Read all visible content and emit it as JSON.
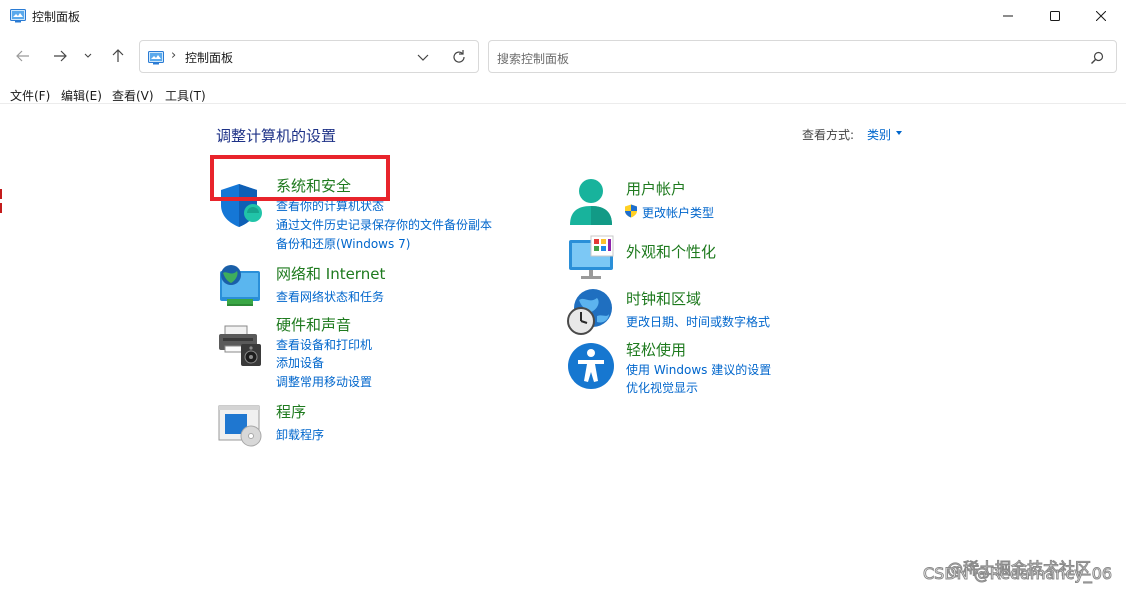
{
  "window": {
    "title": "控制面板"
  },
  "address_bar": {
    "separator": "›",
    "path": "控制面板"
  },
  "search": {
    "placeholder": "搜索控制面板"
  },
  "menu": [
    "文件(F)",
    "编辑(E)",
    "查看(V)",
    "工具(T)"
  ],
  "page": {
    "title": "调整计算机的设置",
    "view_by_label": "查看方式:",
    "view_by_value": "类别"
  },
  "categories": [
    {
      "title": "系统和安全",
      "icon": "shield-icon",
      "links": [
        "查看你的计算机状态",
        "通过文件历史记录保存你的文件备份副本",
        "备份和还原(Windows 7)"
      ]
    },
    {
      "title": "网络和 Internet",
      "icon": "network-globe-icon",
      "links": [
        "查看网络状态和任务"
      ]
    },
    {
      "title": "硬件和声音",
      "icon": "printer-speaker-icon",
      "links": [
        "查看设备和打印机",
        "添加设备",
        "调整常用移动设置"
      ]
    },
    {
      "title": "程序",
      "icon": "programs-icon",
      "links": [
        "卸载程序"
      ]
    },
    {
      "title": "用户帐户",
      "icon": "user-account-icon",
      "links": [
        "更改帐户类型"
      ]
    },
    {
      "title": "外观和个性化",
      "icon": "monitor-palette-icon",
      "links": []
    },
    {
      "title": "时钟和区域",
      "icon": "clock-globe-icon",
      "links": [
        "更改日期、时间或数字格式"
      ]
    },
    {
      "title": "轻松使用",
      "icon": "accessibility-icon",
      "links": [
        "使用 Windows 建议的设置",
        "优化视觉显示"
      ]
    }
  ],
  "watermark": {
    "line1": "@稀土掘金技术社区",
    "line2": "CSDN @Redamancy_06"
  },
  "colors": {
    "category_title": "#1e7a1e",
    "link": "#0066cc",
    "page_title": "#1e3287",
    "highlight_box": "#e8242b"
  }
}
